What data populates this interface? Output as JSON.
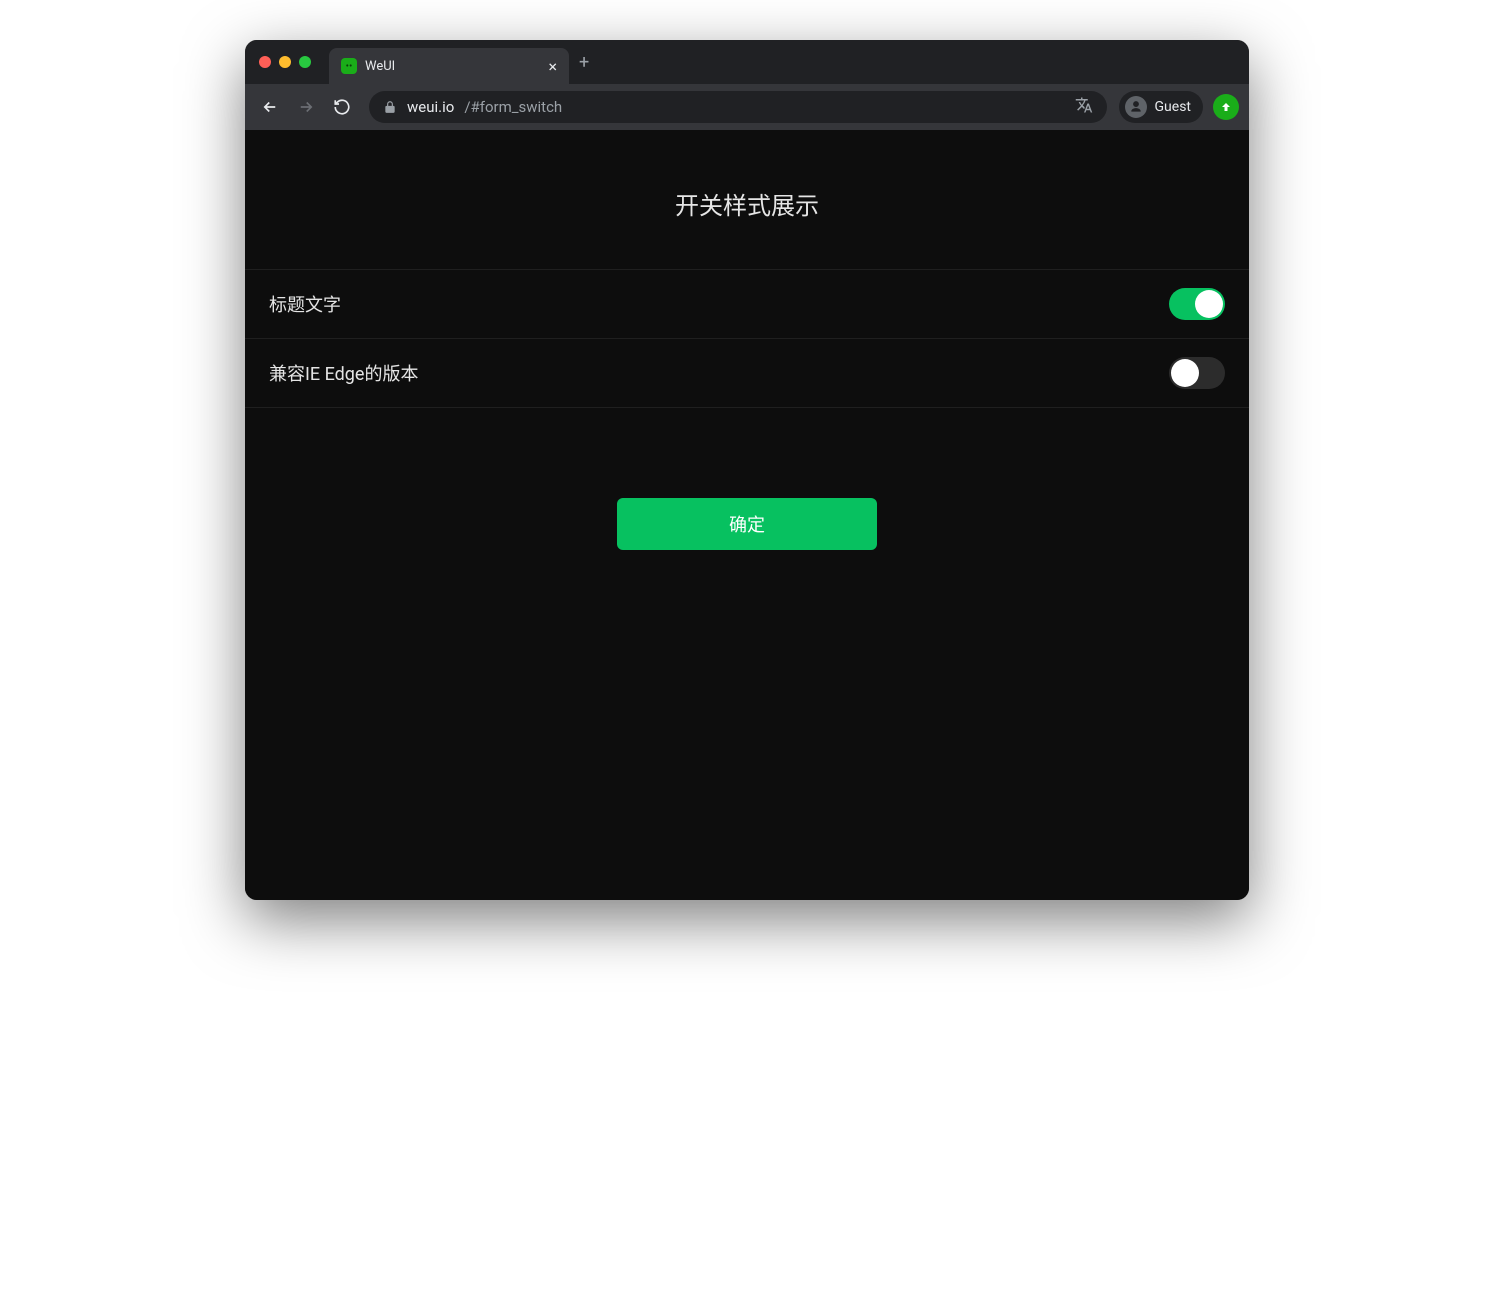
{
  "browser": {
    "tab_title": "WeUI",
    "url_host": "weui.io",
    "url_path": "/#form_switch",
    "profile_label": "Guest"
  },
  "page": {
    "title": "开关样式展示",
    "cells": [
      {
        "label": "标题文字",
        "on": true
      },
      {
        "label": "兼容IE Edge的版本",
        "on": false
      }
    ],
    "submit_label": "确定"
  },
  "colors": {
    "accent": "#07c160",
    "page_bg": "#0d0d0d"
  }
}
